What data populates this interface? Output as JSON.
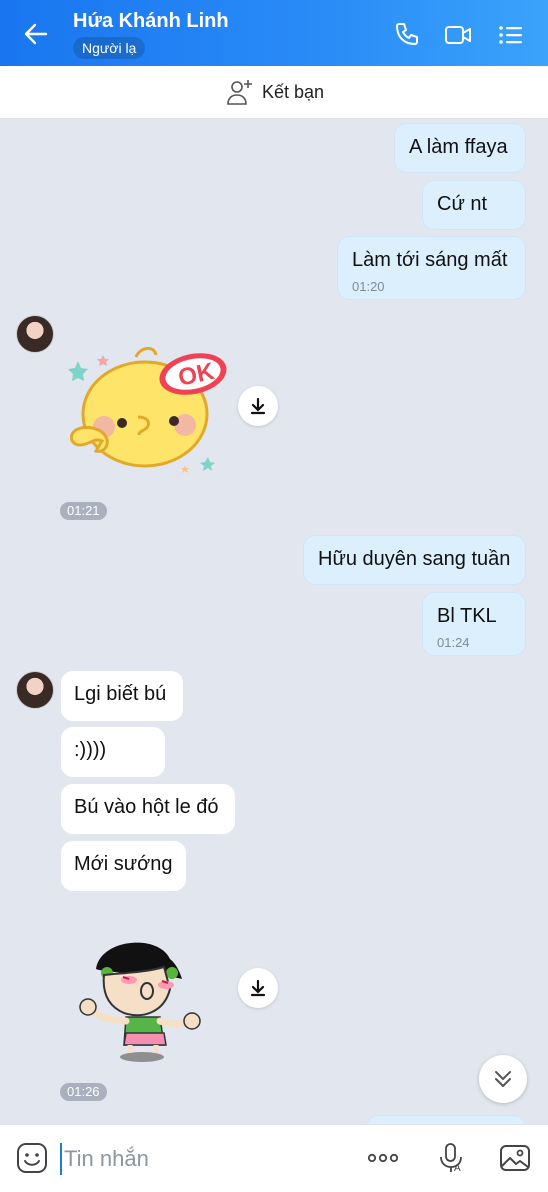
{
  "header": {
    "contact_name": "Hứa Khánh Linh",
    "relation_badge": "Người lạ",
    "icons": [
      "back-arrow-icon",
      "phone-icon",
      "video-call-icon",
      "menu-icon"
    ],
    "background": "#1f7ef2"
  },
  "add_friend": {
    "label": "Kết bạn",
    "icon": "add-friend-icon"
  },
  "messages": [
    {
      "from": "me",
      "text": "A làm ffaya"
    },
    {
      "from": "me",
      "text": "Cứ nt"
    },
    {
      "from": "me",
      "text": "Làm tới sáng mất",
      "time": "01:20"
    },
    {
      "from": "them",
      "type": "sticker",
      "sticker": "chick-ok-sticker",
      "time": "01:21"
    },
    {
      "from": "me",
      "text": "Hữu duyên sang tuần"
    },
    {
      "from": "me",
      "text": "Bl TKL",
      "time": "01:24"
    },
    {
      "from": "them",
      "text": "Lgi biết bú"
    },
    {
      "from": "them",
      "text": ":))))"
    },
    {
      "from": "them",
      "text": "Bú vào hột le đó"
    },
    {
      "from": "them",
      "text": "Mới sướng"
    },
    {
      "from": "them",
      "type": "sticker",
      "sticker": "girl-kiss-sticker",
      "time": "01:26"
    }
  ],
  "composer": {
    "placeholder": "Tin nhắn",
    "value": "",
    "icons": [
      "emoji-icon",
      "more-icon",
      "voice-icon",
      "image-icon"
    ]
  },
  "colors": {
    "my_bubble": "#dbeffd",
    "their_bubble": "#ffffff",
    "chat_bg": "#e2e7ef"
  }
}
